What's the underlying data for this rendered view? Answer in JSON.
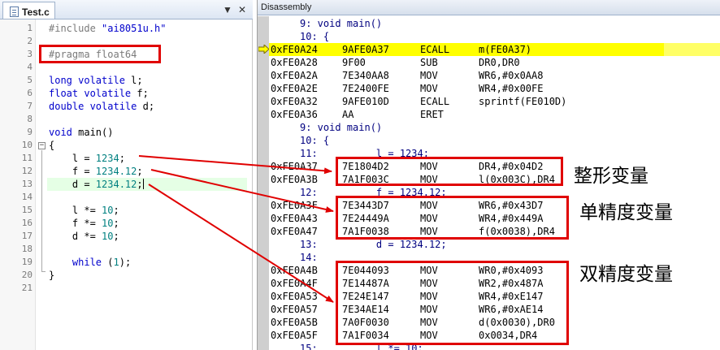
{
  "editor": {
    "tab_label": "Test.c",
    "line_numbers": [
      "1",
      "2",
      "3",
      "4",
      "5",
      "6",
      "7",
      "8",
      "9",
      "10",
      "11",
      "12",
      "13",
      "14",
      "15",
      "16",
      "17",
      "18",
      "19",
      "20",
      "21"
    ]
  },
  "disassembly": {
    "title": "Disassembly",
    "rows": [
      {
        "addr": "",
        "bytes": "",
        "op": "",
        "args": "",
        "src": "9: void main()"
      },
      {
        "addr": "",
        "bytes": "",
        "op": "",
        "args": "",
        "src": "10: {"
      },
      {
        "addr": "0xFE0A24",
        "bytes": "9AFE0A37",
        "op": "ECALL",
        "args": "m(FE0A37)"
      },
      {
        "addr": "0xFE0A28",
        "bytes": "9F00",
        "op": "SUB",
        "args": "DR0,DR0"
      },
      {
        "addr": "0xFE0A2A",
        "bytes": "7E340AA8",
        "op": "MOV",
        "args": "WR6,#0x0AA8"
      },
      {
        "addr": "0xFE0A2E",
        "bytes": "7E2400FE",
        "op": "MOV",
        "args": "WR4,#0x00FE"
      },
      {
        "addr": "0xFE0A32",
        "bytes": "9AFE010D",
        "op": "ECALL",
        "args": "sprintf(FE010D)"
      },
      {
        "addr": "0xFE0A36",
        "bytes": "AA",
        "op": "ERET",
        "args": ""
      },
      {
        "addr": "",
        "bytes": "",
        "op": "",
        "args": "",
        "src": "9: void main()"
      },
      {
        "addr": "",
        "bytes": "",
        "op": "",
        "args": "",
        "src": "10: {"
      },
      {
        "addr": "",
        "bytes": "",
        "op": "",
        "args": "",
        "src": "11:          l = 1234;"
      },
      {
        "addr": "0xFE0A37",
        "bytes": "7E1804D2",
        "op": "MOV",
        "args": "DR4,#0x04D2"
      },
      {
        "addr": "0xFE0A3B",
        "bytes": "7A1F003C",
        "op": "MOV",
        "args": "l(0x003C),DR4"
      },
      {
        "addr": "",
        "bytes": "",
        "op": "",
        "args": "",
        "src": "12:          f = 1234.12;"
      },
      {
        "addr": "0xFE0A3F",
        "bytes": "7E3443D7",
        "op": "MOV",
        "args": "WR6,#0x43D7"
      },
      {
        "addr": "0xFE0A43",
        "bytes": "7E24449A",
        "op": "MOV",
        "args": "WR4,#0x449A"
      },
      {
        "addr": "0xFE0A47",
        "bytes": "7A1F0038",
        "op": "MOV",
        "args": "f(0x0038),DR4"
      },
      {
        "addr": "",
        "bytes": "",
        "op": "",
        "args": "",
        "src": "13:          d = 1234.12;"
      },
      {
        "addr": "",
        "bytes": "",
        "op": "",
        "args": "",
        "src": "14:"
      },
      {
        "addr": "0xFE0A4B",
        "bytes": "7E044093",
        "op": "MOV",
        "args": "WR0,#0x4093"
      },
      {
        "addr": "0xFE0A4F",
        "bytes": "7E14487A",
        "op": "MOV",
        "args": "WR2,#0x487A"
      },
      {
        "addr": "0xFE0A53",
        "bytes": "7E24E147",
        "op": "MOV",
        "args": "WR4,#0xE147"
      },
      {
        "addr": "0xFE0A57",
        "bytes": "7E34AE14",
        "op": "MOV",
        "args": "WR6,#0xAE14"
      },
      {
        "addr": "0xFE0A5B",
        "bytes": "7A0F0030",
        "op": "MOV",
        "args": "d(0x0030),DR0"
      },
      {
        "addr": "0xFE0A5F",
        "bytes": "7A1F0034",
        "op": "MOV",
        "args": "0x0034,DR4"
      },
      {
        "addr": "",
        "bytes": "",
        "op": "",
        "args": "",
        "src": "15:          l *= 10;"
      }
    ]
  },
  "annotations": {
    "integer": "整形变量",
    "single": "单精度变量",
    "double": "双精度变量"
  },
  "code": {
    "include_kw": "#include",
    "include_str": "\"ai8051u.h\"",
    "pragma": "#pragma float64",
    "decl_l_kw": "long volatile",
    "decl_l_id": " l;",
    "decl_f_kw": "float volatile",
    "decl_f_id": " f;",
    "decl_d_kw": "double volatile",
    "decl_d_id": " d;",
    "main_kw": "void",
    "main_id": " main()",
    "brace_open": "{",
    "a1_id": "    l = ",
    "a1_num": "1234",
    "a1_end": ";",
    "a2_id": "    f = ",
    "a2_num": "1234.12",
    "a2_end": ";",
    "a3_id": "    d = ",
    "a3_num": "1234.12",
    "a3_end": ";",
    "m1_id": "    l *= ",
    "m1_num": "10",
    "m1_end": ";",
    "m2_id": "    f *= ",
    "m2_num": "10",
    "m2_end": ";",
    "m3_id": "    d *= ",
    "m3_num": "10",
    "m3_end": ";",
    "while_kw": "    while",
    "while_id": " (",
    "while_num": "1",
    "while_end": ");",
    "brace_close": "}"
  },
  "colors": {
    "annotation_red": "#e00000",
    "current_line_yellow": "#ffff00",
    "keyword_blue": "#0000cc"
  }
}
